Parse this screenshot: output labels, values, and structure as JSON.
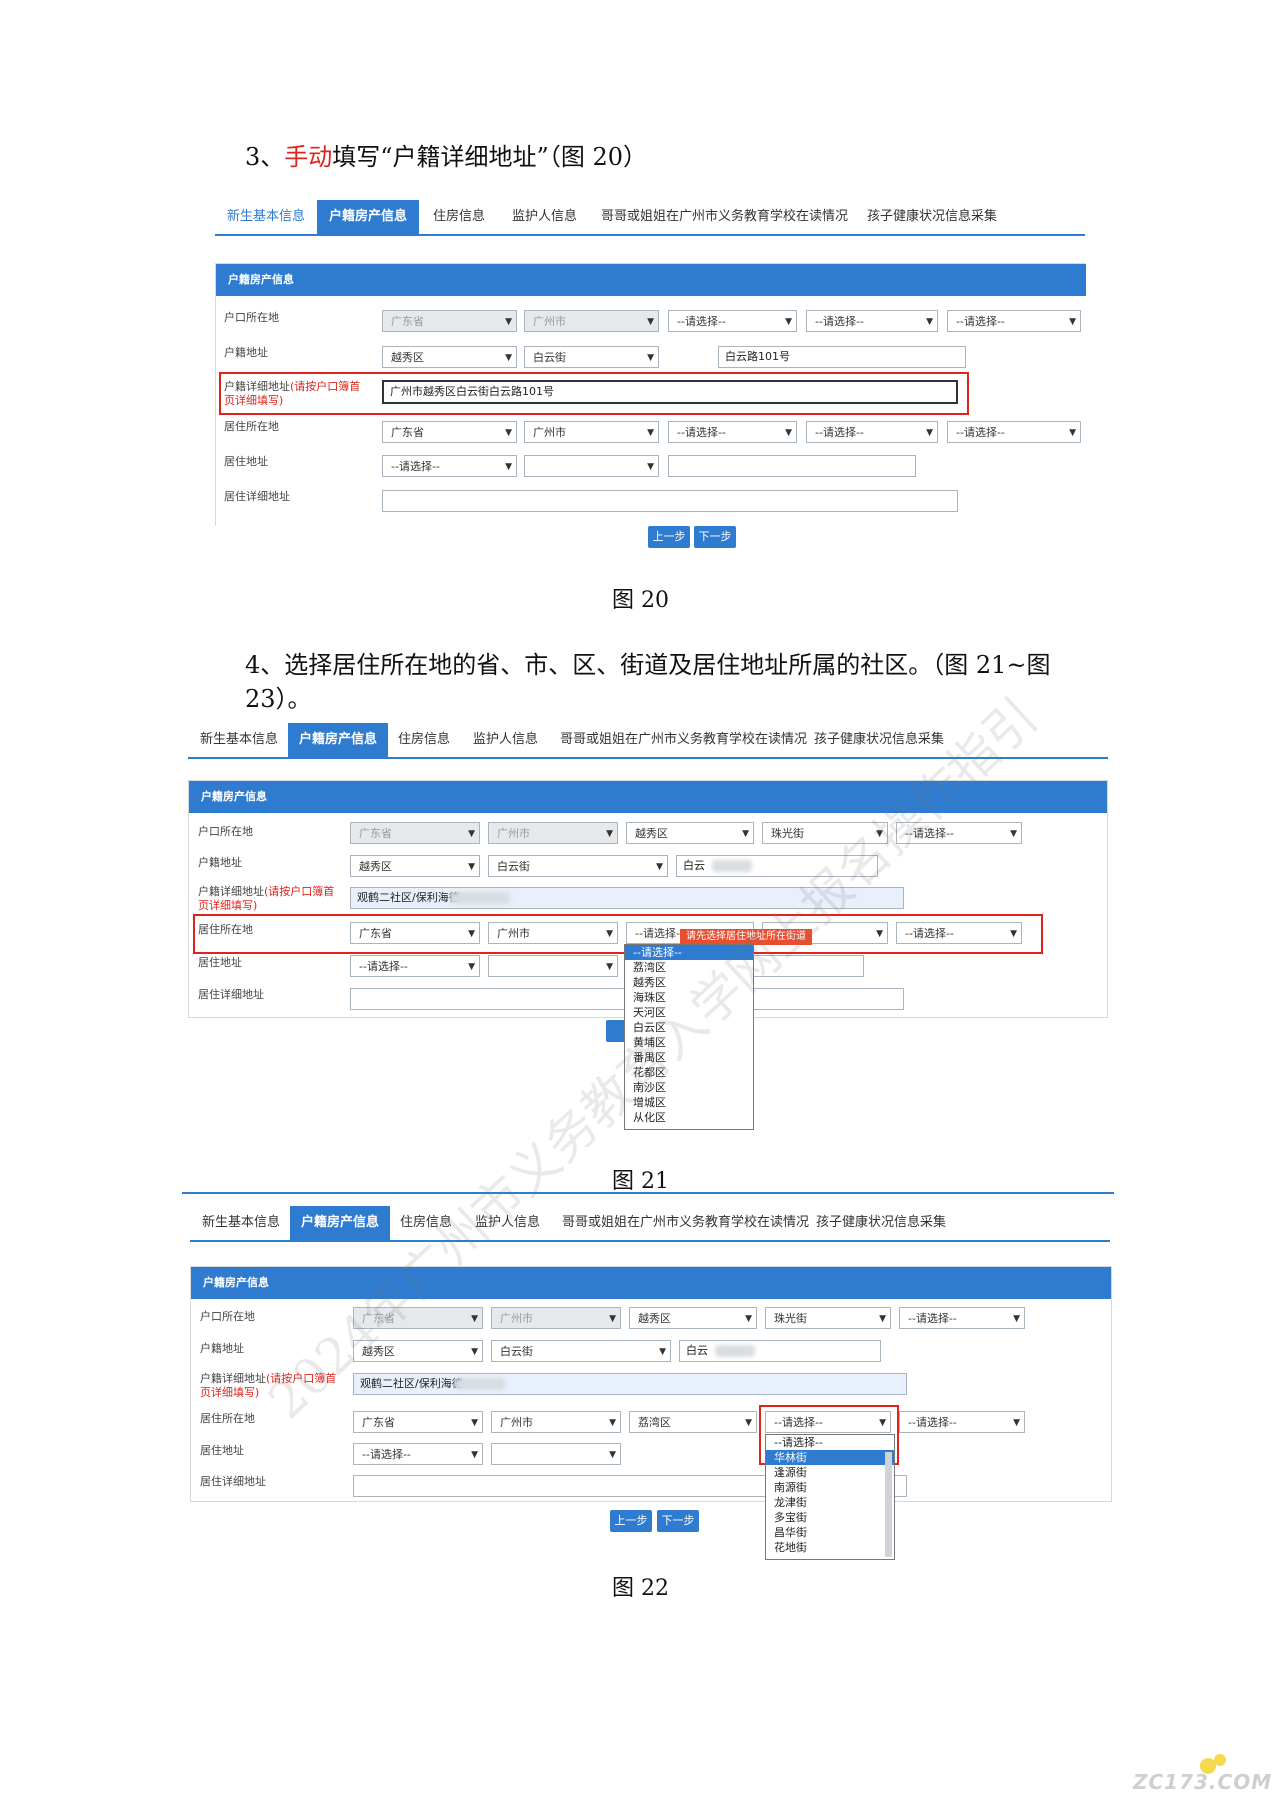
{
  "section3": {
    "num": "3、",
    "red": "手动",
    "rest": "填写“户籍详细地址”（图 20）",
    "caption": "图 20"
  },
  "section4": {
    "line1": "4、选择居住所在地的省、市、区、街道及居住地址所属的社区。（图 21~图",
    "line2": "23）。",
    "caption21": "图 21",
    "caption22": "图 22"
  },
  "tabs": [
    "新生基本信息",
    "户籍房产信息",
    "住房信息",
    "监护人信息",
    "哥哥或姐姐在广州市义务教育学校在读情况",
    "孩子健康状况信息采集"
  ],
  "panel_title": "户籍房产信息",
  "labels": {
    "hukou_loc": "户口所在地",
    "huji_addr": "户籍地址",
    "huji_detail": "户籍详细地址",
    "huji_detail_note": "(请按户口簿首页详细填写)",
    "note_a": "(请按户口簿首",
    "note_b": "页详细填写)",
    "live_loc": "居住所在地",
    "live_addr": "居住地址",
    "live_detail": "居住详细地址"
  },
  "values": {
    "gd": "广东省",
    "gz": "广州市",
    "pick": "--请选择--",
    "yuexiu": "越秀区",
    "baiyun_st": "白云街",
    "road": "白云路101号",
    "road_short": "白云路",
    "full_addr": "广州市越秀区白云街白云路101号",
    "zhuguang": "珠光街",
    "guanhe": "观鹤二社区/保利海德",
    "liwan": "荔湾区",
    "road_prefix": "白云"
  },
  "buttons": {
    "prev": "上一步",
    "next": "下一步"
  },
  "tooltip": "请先选择居住地址所在街道",
  "district_options": [
    "--请选择--",
    "荔湾区",
    "越秀区",
    "海珠区",
    "天河区",
    "白云区",
    "黄埔区",
    "番禺区",
    "花都区",
    "南沙区",
    "增城区",
    "从化区"
  ],
  "street_options": [
    "--请选择--",
    "华林街",
    "逢源街",
    "南源街",
    "龙津街",
    "多宝街",
    "昌华街",
    "花地街"
  ],
  "watermark": "2024年广州市义务教育入学网上报名操作指引",
  "logo": "ZC173.COM"
}
